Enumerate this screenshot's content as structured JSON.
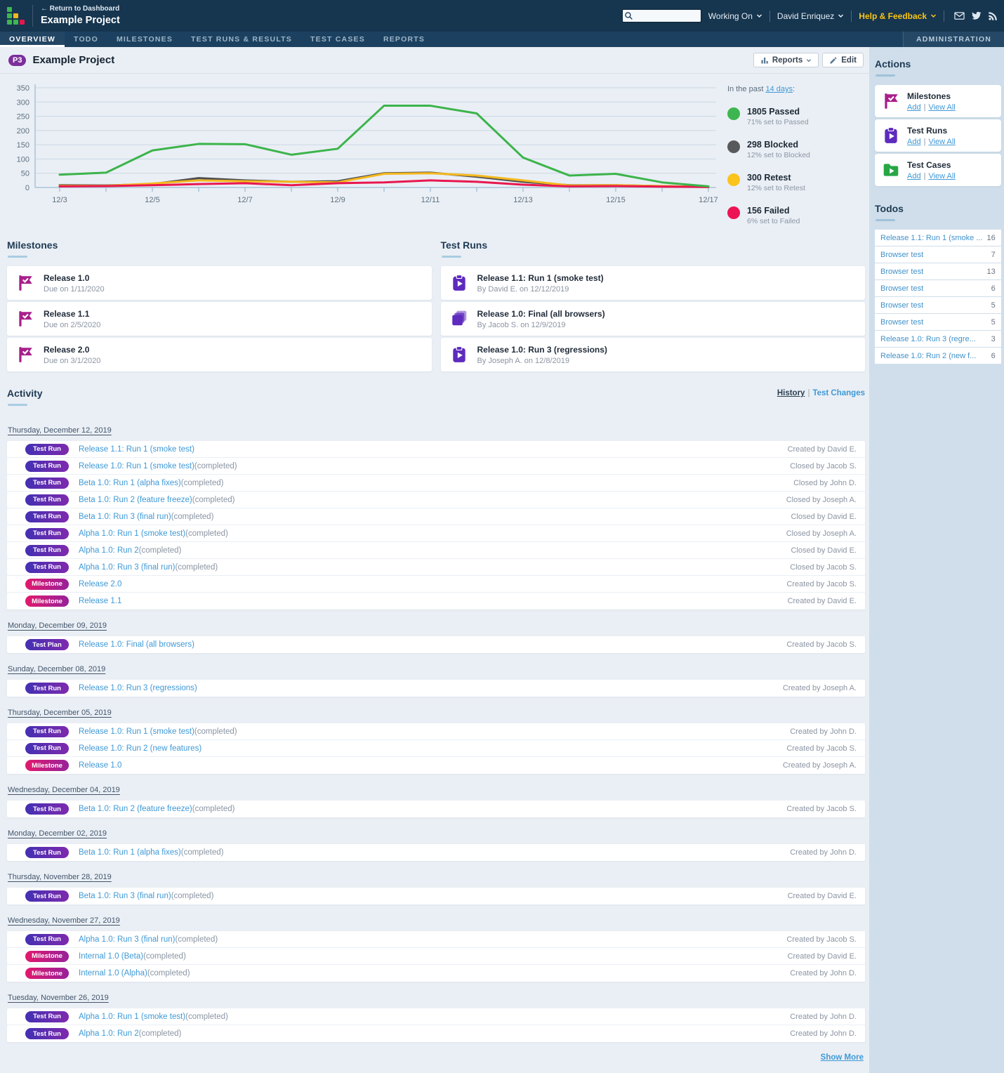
{
  "topbar": {
    "return_link": "← Return to Dashboard",
    "project_title": "Example Project",
    "working_on": "Working On",
    "user_name": "David Enriquez",
    "help_feedback": "Help & Feedback"
  },
  "nav": {
    "tabs": [
      {
        "label": "OVERVIEW",
        "state": "active"
      },
      {
        "label": "TODO",
        "state": ""
      },
      {
        "label": "MILESTONES",
        "state": ""
      },
      {
        "label": "TEST RUNS & RESULTS",
        "state": ""
      },
      {
        "label": "TEST CASES",
        "state": ""
      },
      {
        "label": "REPORTS",
        "state": ""
      }
    ],
    "admin_tab": "ADMINISTRATION"
  },
  "page": {
    "badge": "P3",
    "title": "Example Project",
    "reports_button": "Reports",
    "edit_button": "Edit"
  },
  "chart_data": {
    "type": "line",
    "categories": [
      "12/3",
      "12/4",
      "12/5",
      "12/6",
      "12/7",
      "12/8",
      "12/9",
      "12/10",
      "12/11",
      "12/12",
      "12/13",
      "12/14",
      "12/15",
      "12/16",
      "12/17"
    ],
    "x_label_every": 2,
    "ylim": [
      0,
      350
    ],
    "yticks": [
      0,
      50,
      100,
      150,
      200,
      250,
      300,
      350
    ],
    "grid": true,
    "legend_position": "right",
    "series": [
      {
        "name": "Passed",
        "color": "#3cb44b",
        "values": [
          45,
          52,
          130,
          153,
          152,
          115,
          136,
          287,
          287,
          260,
          105,
          42,
          48,
          18,
          4
        ]
      },
      {
        "name": "Blocked",
        "color": "#4d4d4f",
        "values": [
          8,
          7,
          12,
          33,
          25,
          20,
          22,
          50,
          52,
          38,
          20,
          8,
          8,
          5,
          2
        ]
      },
      {
        "name": "Retest",
        "color": "#f5b91e",
        "values": [
          6,
          6,
          14,
          25,
          22,
          20,
          18,
          48,
          50,
          42,
          25,
          7,
          8,
          5,
          2
        ]
      },
      {
        "name": "Failed",
        "color": "#e8174f",
        "values": [
          4,
          5,
          8,
          12,
          15,
          8,
          15,
          18,
          25,
          20,
          10,
          4,
          5,
          3,
          2
        ]
      }
    ]
  },
  "summary": {
    "prefix": "In the past",
    "range_link": "14 days",
    "suffix": ":",
    "items": [
      {
        "count_label": "1805 Passed",
        "subtext": "71% set to Passed",
        "color": "#3eb650"
      },
      {
        "count_label": "298 Blocked",
        "subtext": "12% set to Blocked",
        "color": "#58595b"
      },
      {
        "count_label": "300 Retest",
        "subtext": "12% set to Retest",
        "color": "#fac41d"
      },
      {
        "count_label": "156 Failed",
        "subtext": "6% set to Failed",
        "color": "#ed1455"
      }
    ]
  },
  "milestones_section": {
    "title": "Milestones",
    "items": [
      {
        "icon": "milestone",
        "title": "Release 1.0",
        "subtitle": "Due on 1/11/2020"
      },
      {
        "icon": "milestone",
        "title": "Release 1.1",
        "subtitle": "Due on 2/5/2020"
      },
      {
        "icon": "milestone",
        "title": "Release 2.0",
        "subtitle": "Due on 3/1/2020"
      }
    ]
  },
  "testruns_section": {
    "title": "Test Runs",
    "items": [
      {
        "icon": "test-run",
        "title": "Release 1.1: Run 1 (smoke test)",
        "subtitle": "By David E. on 12/12/2019"
      },
      {
        "icon": "test-plan",
        "title": "Release 1.0: Final (all browsers)",
        "subtitle": "By Jacob S. on 12/9/2019"
      },
      {
        "icon": "test-run",
        "title": "Release 1.0: Run 3 (regressions)",
        "subtitle": "By Joseph A. on 12/8/2019"
      }
    ]
  },
  "activity": {
    "title": "Activity",
    "links": {
      "history": "History",
      "separator": "|",
      "test_changes": "Test Changes"
    },
    "show_more": "Show More",
    "groups": [
      {
        "date": "Thursday, December 12, 2019",
        "rows": [
          {
            "type": "run",
            "badge": "Test Run",
            "link": "Release 1.1: Run 1 (smoke test)",
            "suffix": "",
            "meta": "Created by David E."
          },
          {
            "type": "run",
            "badge": "Test Run",
            "link": "Release 1.0: Run 1 (smoke test)",
            "suffix": "(completed)",
            "meta": "Closed by Jacob S."
          },
          {
            "type": "run",
            "badge": "Test Run",
            "link": "Beta 1.0: Run 1 (alpha fixes)",
            "suffix": "(completed)",
            "meta": "Closed by John D."
          },
          {
            "type": "run",
            "badge": "Test Run",
            "link": "Beta 1.0: Run 2 (feature freeze)",
            "suffix": "(completed)",
            "meta": "Closed by Joseph A."
          },
          {
            "type": "run",
            "badge": "Test Run",
            "link": "Beta 1.0: Run 3 (final run)",
            "suffix": "(completed)",
            "meta": "Closed by David E."
          },
          {
            "type": "run",
            "badge": "Test Run",
            "link": "Alpha 1.0: Run 1 (smoke test)",
            "suffix": "(completed)",
            "meta": "Closed by Joseph A."
          },
          {
            "type": "run",
            "badge": "Test Run",
            "link": "Alpha 1.0: Run 2",
            "suffix": "(completed)",
            "meta": "Closed by David E."
          },
          {
            "type": "run",
            "badge": "Test Run",
            "link": "Alpha 1.0: Run 3 (final run)",
            "suffix": "(completed)",
            "meta": "Closed by Jacob S."
          },
          {
            "type": "milestone",
            "badge": "Milestone",
            "link": "Release 2.0",
            "suffix": "",
            "meta": "Created by Jacob S."
          },
          {
            "type": "milestone",
            "badge": "Milestone",
            "link": "Release 1.1",
            "suffix": "",
            "meta": "Created by David E."
          }
        ]
      },
      {
        "date": "Monday, December 09, 2019",
        "rows": [
          {
            "type": "plan",
            "badge": "Test Plan",
            "link": "Release 1.0: Final (all browsers)",
            "suffix": "",
            "meta": "Created by Jacob S."
          }
        ]
      },
      {
        "date": "Sunday, December 08, 2019",
        "rows": [
          {
            "type": "run",
            "badge": "Test Run",
            "link": "Release 1.0: Run 3 (regressions)",
            "suffix": "",
            "meta": "Created by Joseph A."
          }
        ]
      },
      {
        "date": "Thursday, December 05, 2019",
        "rows": [
          {
            "type": "run",
            "badge": "Test Run",
            "link": "Release 1.0: Run 1 (smoke test)",
            "suffix": "(completed)",
            "meta": "Created by John D."
          },
          {
            "type": "run",
            "badge": "Test Run",
            "link": "Release 1.0: Run 2 (new features)",
            "suffix": "",
            "meta": "Created by Jacob S."
          },
          {
            "type": "milestone",
            "badge": "Milestone",
            "link": "Release 1.0",
            "suffix": "",
            "meta": "Created by Joseph A."
          }
        ]
      },
      {
        "date": "Wednesday, December 04, 2019",
        "rows": [
          {
            "type": "run",
            "badge": "Test Run",
            "link": "Beta 1.0: Run 2 (feature freeze)",
            "suffix": "(completed)",
            "meta": "Created by Jacob S."
          }
        ]
      },
      {
        "date": "Monday, December 02, 2019",
        "rows": [
          {
            "type": "run",
            "badge": "Test Run",
            "link": "Beta 1.0: Run 1 (alpha fixes)",
            "suffix": "(completed)",
            "meta": "Created by John D."
          }
        ]
      },
      {
        "date": "Thursday, November 28, 2019",
        "rows": [
          {
            "type": "run",
            "badge": "Test Run",
            "link": "Beta 1.0: Run 3 (final run)",
            "suffix": "(completed)",
            "meta": "Created by David E."
          }
        ]
      },
      {
        "date": "Wednesday, November 27, 2019",
        "rows": [
          {
            "type": "run",
            "badge": "Test Run",
            "link": "Alpha 1.0: Run 3 (final run)",
            "suffix": "(completed)",
            "meta": "Created by Jacob S."
          },
          {
            "type": "milestone",
            "badge": "Milestone",
            "link": "Internal 1.0 (Beta)",
            "suffix": "(completed)",
            "meta": "Created by David E."
          },
          {
            "type": "milestone",
            "badge": "Milestone",
            "link": "Internal 1.0 (Alpha)",
            "suffix": "(completed)",
            "meta": "Created by John D."
          }
        ]
      },
      {
        "date": "Tuesday, November 26, 2019",
        "rows": [
          {
            "type": "run",
            "badge": "Test Run",
            "link": "Alpha 1.0: Run 1 (smoke test)",
            "suffix": "(completed)",
            "meta": "Created by John D."
          },
          {
            "type": "run",
            "badge": "Test Run",
            "link": "Alpha 1.0: Run 2",
            "suffix": "(completed)",
            "meta": "Created by John D."
          }
        ]
      }
    ]
  },
  "sidebar": {
    "actions_title": "Actions",
    "cards": [
      {
        "icon": "milestone",
        "title": "Milestones",
        "add_label": "Add",
        "separator": "|",
        "view_all_label": "View All"
      },
      {
        "icon": "test-run",
        "title": "Test Runs",
        "add_label": "Add",
        "separator": "|",
        "view_all_label": "View All"
      },
      {
        "icon": "test-case",
        "title": "Test Cases",
        "add_label": "Add",
        "separator": "|",
        "view_all_label": "View All"
      }
    ],
    "todos_title": "Todos",
    "todos": [
      {
        "label": "Release 1.1: Run 1 (smoke ...",
        "count": "16"
      },
      {
        "label": "Browser test",
        "count": "7"
      },
      {
        "label": "Browser test",
        "count": "13"
      },
      {
        "label": "Browser test",
        "count": "6"
      },
      {
        "label": "Browser test",
        "count": "5"
      },
      {
        "label": "Browser test",
        "count": "5"
      },
      {
        "label": "Release 1.0: Run 3 (regre...",
        "count": "3"
      },
      {
        "label": "Release 1.0: Run 2 (new f...",
        "count": "6"
      }
    ]
  }
}
